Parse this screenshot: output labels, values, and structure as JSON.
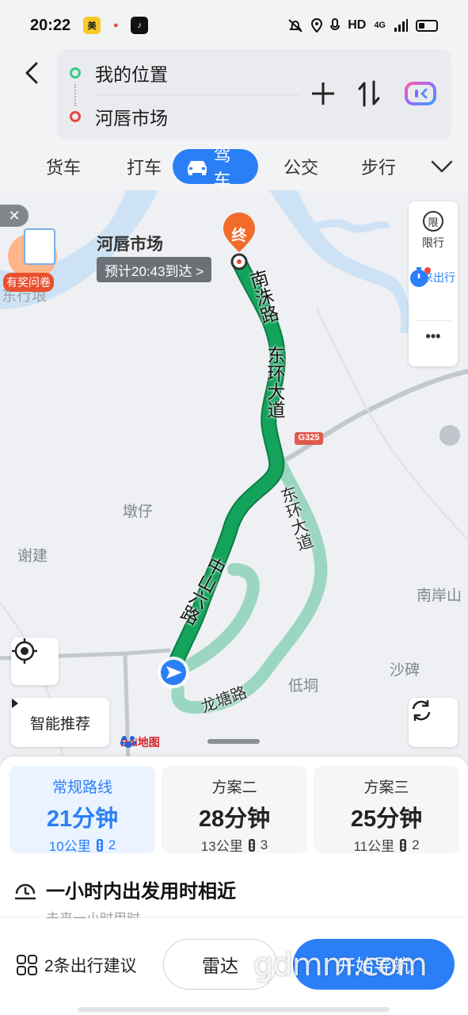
{
  "status_bar": {
    "time": "20:22",
    "right_text": "HD",
    "network": "4G",
    "app_icons": [
      "meituan-icon",
      "map-pin-app-icon",
      "tiktok-icon"
    ]
  },
  "route_input": {
    "origin": "我的位置",
    "destination": "河唇市场"
  },
  "modes": [
    {
      "label": "货车",
      "active": false
    },
    {
      "label": "打车",
      "active": false
    },
    {
      "label": "驾车",
      "active": true
    },
    {
      "label": "公交",
      "active": false
    },
    {
      "label": "步行",
      "active": false
    }
  ],
  "map": {
    "destination_name": "河唇市场",
    "eta": "预计20:43到达 >",
    "end_marker": "终",
    "roads": {
      "nanzhu": "南洙路",
      "donghuan_main": "东环大道",
      "donghuan_alt": "东环大道",
      "zhongshan": "中山六路",
      "longtang": "龙塘路",
      "highway_shield": "G325"
    },
    "places": {
      "dunzi": "墩仔",
      "xiejian": "谢建",
      "nananshan": "南岸山",
      "shabei": "沙碑",
      "dijiong": "低垌",
      "dongxing": "东行垠"
    },
    "side_panel": {
      "restrict_label": "限行",
      "restrict_glyph": "限",
      "future_label": "未来出行",
      "more_glyph": "•••"
    },
    "promo_label": "有奖问卷",
    "smart_recommend": "智能推荐",
    "baidu_logo": "Bai地图",
    "colors": {
      "route_main": "#13a35b",
      "route_alt": "#9bd7c0",
      "water": "#cde3f5",
      "accent": "#2b7ff6"
    }
  },
  "routes": [
    {
      "name": "常规路线",
      "time": "21分钟",
      "distance": "10公里",
      "lights": "2",
      "active": true
    },
    {
      "name": "方案二",
      "time": "28分钟",
      "distance": "13公里",
      "lights": "3",
      "active": false
    },
    {
      "name": "方案三",
      "time": "25分钟",
      "distance": "11公里",
      "lights": "2",
      "active": false
    }
  ],
  "hint": {
    "title": "一小时内出发用时相近",
    "subtitle": "未来一小时用时"
  },
  "actions": {
    "advice": "2条出行建议",
    "radar": "雷达",
    "start": "开始导航",
    "watermark": "gdmm.com"
  }
}
